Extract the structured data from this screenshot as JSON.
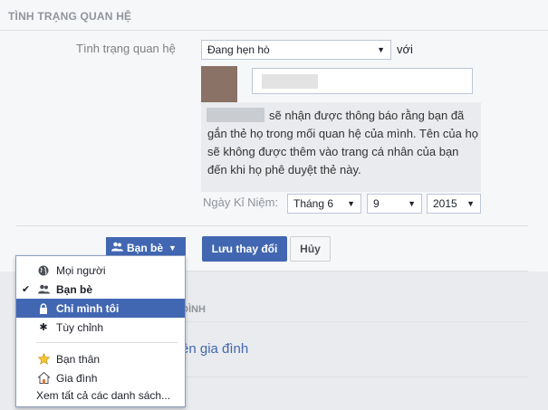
{
  "section": {
    "title": "TÌNH TRẠNG QUAN HỆ"
  },
  "relationship": {
    "label": "Tình trạng quan hệ",
    "status_value": "Đang hẹn hò",
    "with_label": "với"
  },
  "notice": {
    "text": "sẽ nhận được thông báo rằng bạn đã gắn thẻ họ trong mối quan hệ của mình. Tên của họ sẽ không được thêm vào trang cá nhân của bạn đến khi họ phê duyệt thẻ này."
  },
  "anniversary": {
    "label": "Ngày Kỉ Niệm:",
    "month": "Tháng 6",
    "day": "9",
    "year": "2015"
  },
  "actions": {
    "privacy_label": "Bạn bè",
    "save_label": "Lưu thay đổi",
    "cancel_label": "Hủy"
  },
  "lower": {
    "title_fragment": "ĐÌNH",
    "link_fragment": "ên gia đình"
  },
  "privacy_menu": {
    "items": [
      {
        "label": "Mọi người",
        "icon": "globe-icon",
        "checked": false,
        "selected": false
      },
      {
        "label": "Bạn bè",
        "icon": "friends-icon",
        "checked": true,
        "selected": false
      },
      {
        "label": "Chỉ mình tôi",
        "icon": "lock-icon",
        "checked": false,
        "selected": true
      },
      {
        "label": "Tùy chỉnh",
        "icon": "gear-icon",
        "checked": false,
        "selected": false
      },
      {
        "label": "Bạn thân",
        "icon": "star-icon",
        "checked": false,
        "selected": false
      },
      {
        "label": "Gia đình",
        "icon": "house-icon",
        "checked": false,
        "selected": false
      },
      {
        "label": "Xem tất cả các danh sách...",
        "icon": "",
        "checked": false,
        "selected": false
      }
    ]
  },
  "colors": {
    "accent": "#4267b2",
    "background": "#f6f7f9",
    "notice_bg": "#e9ebee"
  }
}
